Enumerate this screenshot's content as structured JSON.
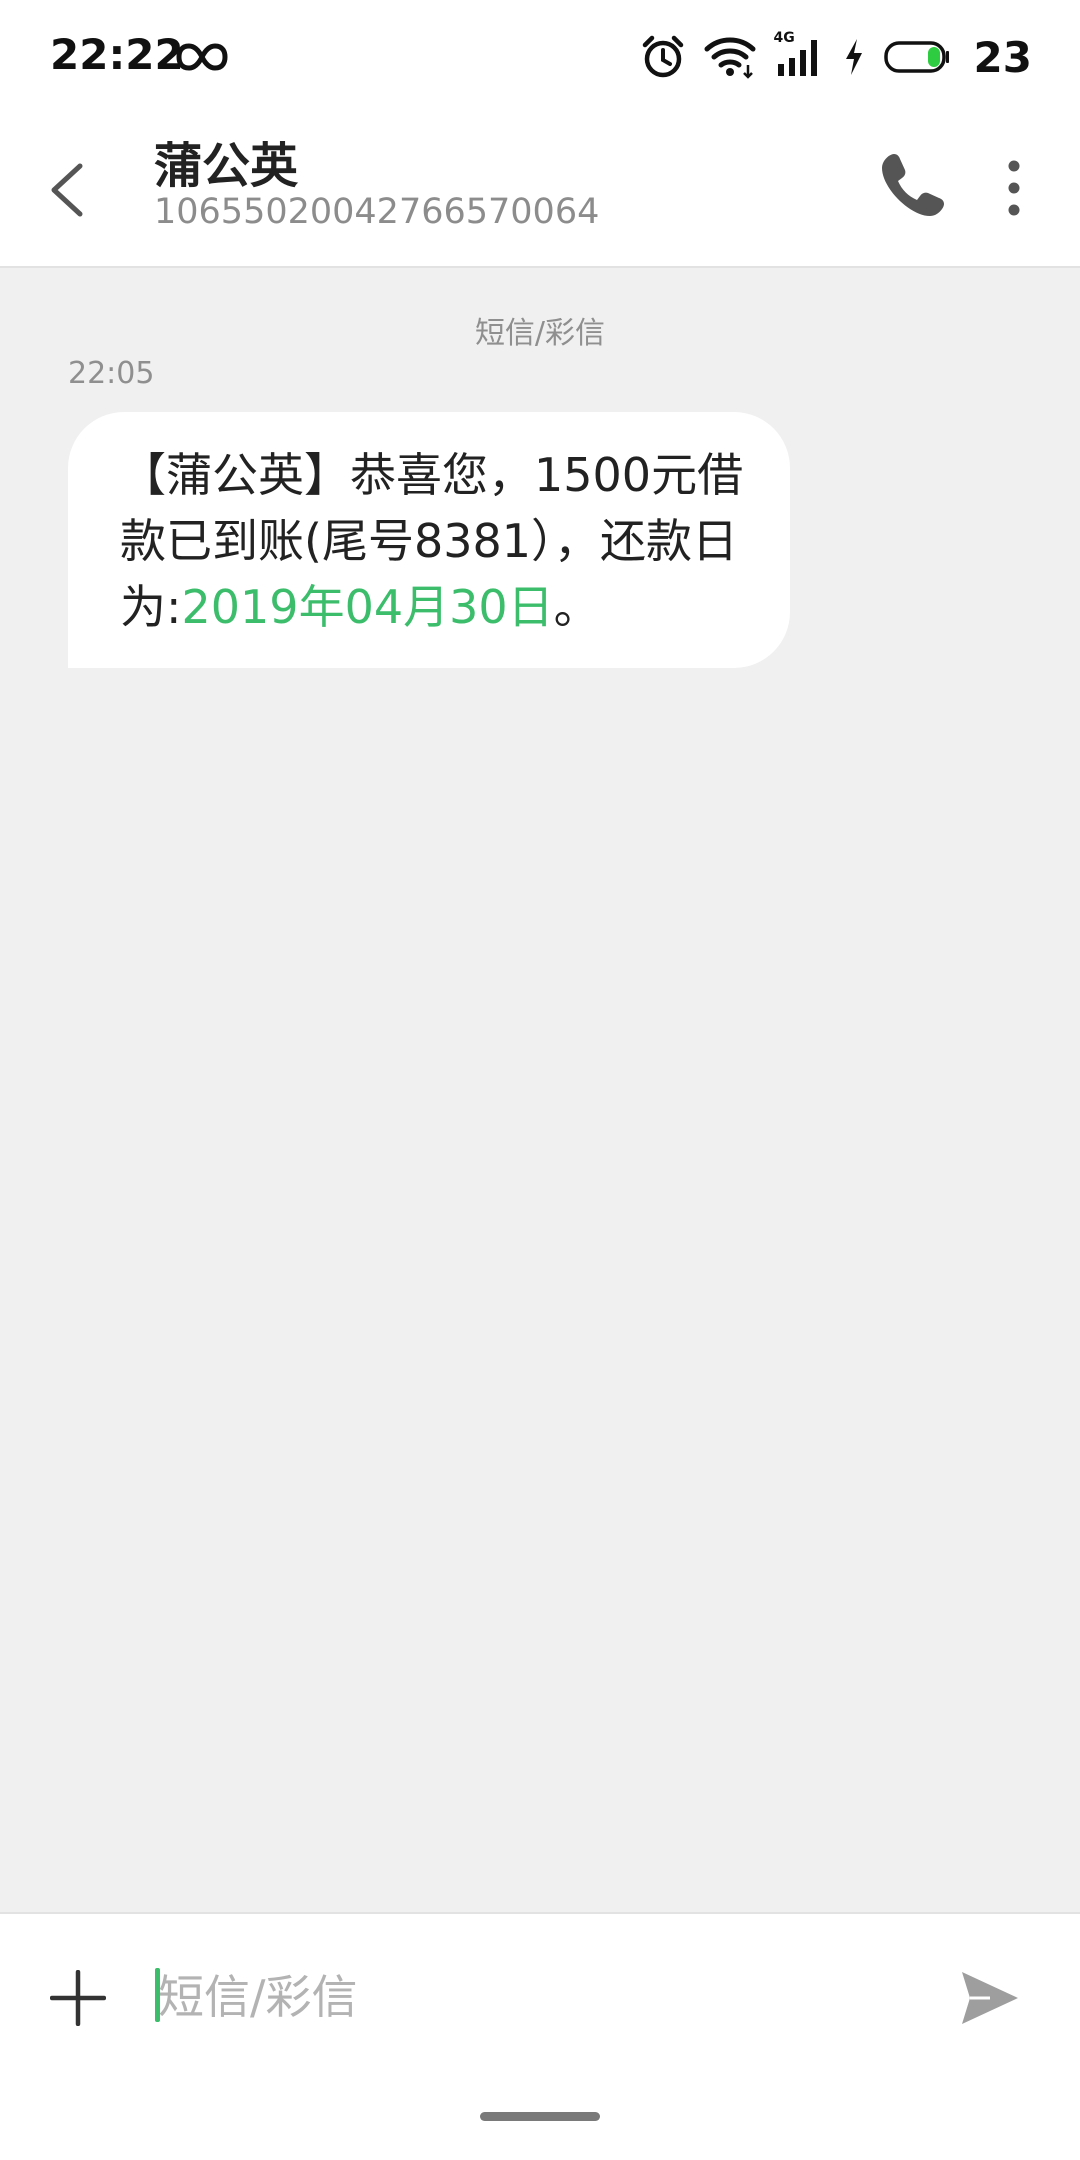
{
  "status_bar": {
    "time": "22:22",
    "network": "4G",
    "battery_level": "23",
    "battery_color": "#2ecc40"
  },
  "header": {
    "contact_name": "蒲公英",
    "contact_number": "1065502004276657006​4"
  },
  "conversation": {
    "channel_label": "短信/彩信",
    "messages": [
      {
        "time": "22:05",
        "text_before": "【蒲公英】恭喜您，1500元借款已到账(尾号8381），还款日为:",
        "highlight": "2019年04月30日",
        "text_after": "。",
        "highlight_color": "#3bbd6b"
      }
    ]
  },
  "compose": {
    "placeholder": "短信/彩信"
  },
  "icons": {
    "back": "back-chevron-icon",
    "call": "phone-icon",
    "more": "more-vertical-icon",
    "add": "plus-icon",
    "send": "send-icon",
    "alarm": "alarm-icon",
    "wifi": "wifi-icon",
    "signal": "signal-icon",
    "charging": "charging-icon",
    "battery": "battery-icon",
    "infinity": "infinity-icon"
  }
}
